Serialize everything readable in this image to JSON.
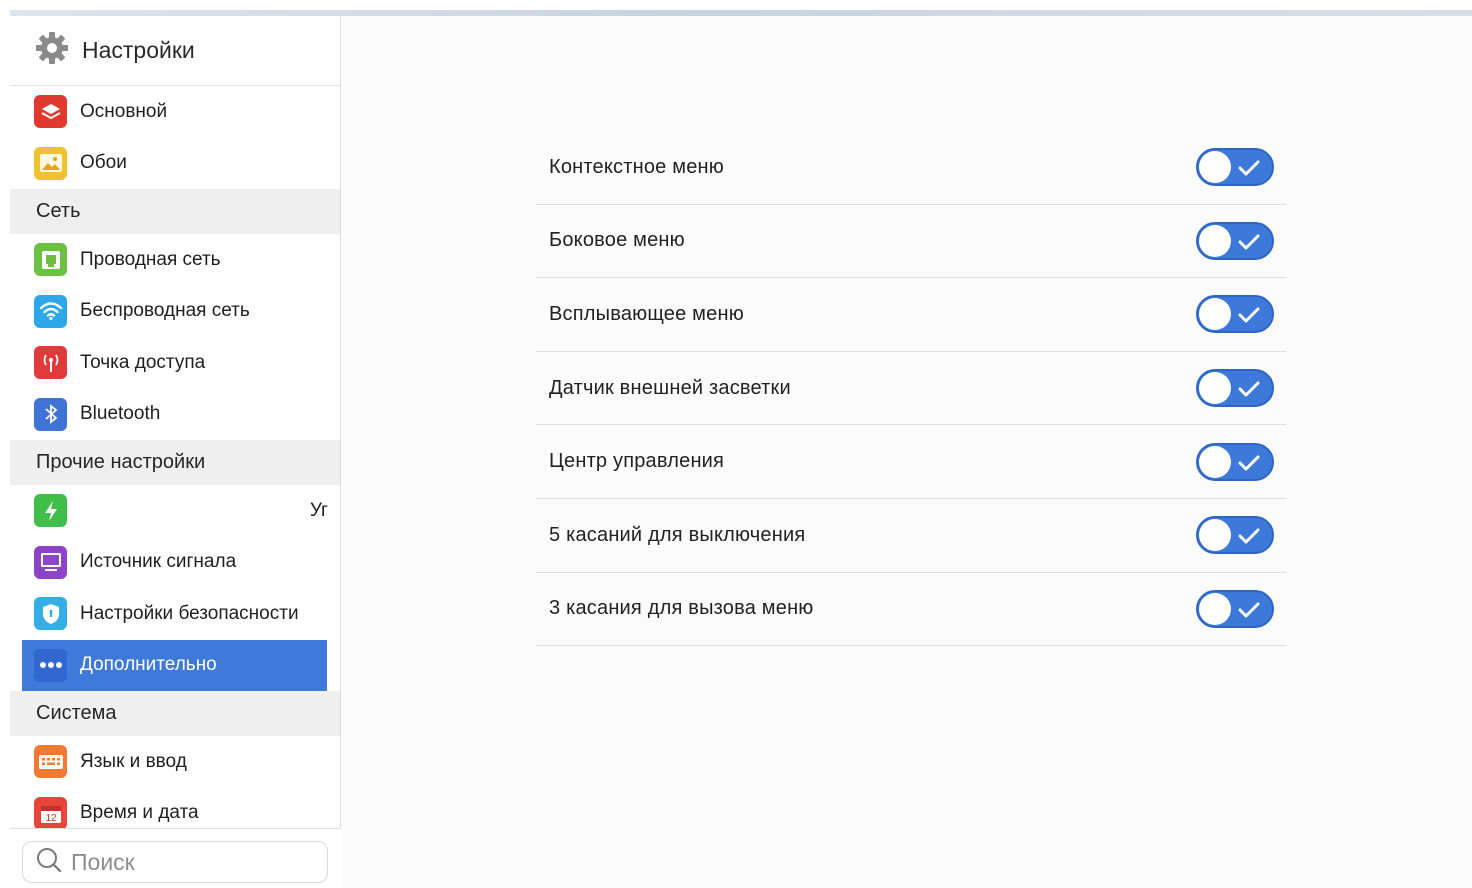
{
  "sidebar": {
    "title": "Настройки",
    "items": [
      {
        "kind": "item",
        "label": "Основной",
        "icon": "layers-icon",
        "color": "#e0392d"
      },
      {
        "kind": "item",
        "label": "Обои",
        "icon": "image-icon",
        "color": "#f2c12e"
      },
      {
        "kind": "section",
        "label": "Сеть"
      },
      {
        "kind": "item",
        "label": "Проводная сеть",
        "icon": "ethernet-icon",
        "color": "#6cc142"
      },
      {
        "kind": "item",
        "label": "Беспроводная сеть",
        "icon": "wifi-icon",
        "color": "#2ea7e8"
      },
      {
        "kind": "item",
        "label": "Точка доступа",
        "icon": "hotspot-icon",
        "color": "#e03a3a"
      },
      {
        "kind": "item",
        "label": "Bluetooth",
        "icon": "bluetooth-icon",
        "color": "#3f74d6"
      },
      {
        "kind": "section",
        "label": "Прочие настройки"
      },
      {
        "kind": "item",
        "label": "",
        "trail": "Уг",
        "icon": "power-icon",
        "color": "#3fbf4a"
      },
      {
        "kind": "item",
        "label": "Источник сигнала",
        "icon": "monitor-icon",
        "color": "#8b44c8"
      },
      {
        "kind": "item",
        "label": "Настройки безопасности",
        "icon": "shield-icon",
        "color": "#35aee6"
      },
      {
        "kind": "item",
        "label": "Дополнительно",
        "icon": "more-icon",
        "color": "#3167cf",
        "selected": true
      },
      {
        "kind": "section",
        "label": "Система"
      },
      {
        "kind": "item",
        "label": "Язык и ввод",
        "icon": "keyboard-icon",
        "color": "#ef7a33"
      },
      {
        "kind": "item",
        "label": "Время и дата",
        "icon": "calendar-icon",
        "color": "#e7453a",
        "badge": "12"
      }
    ]
  },
  "search": {
    "placeholder": "Поиск"
  },
  "settings": [
    {
      "label": "Контекстное меню",
      "on": true
    },
    {
      "label": "Боковое меню",
      "on": true
    },
    {
      "label": "Всплывающее меню",
      "on": true
    },
    {
      "label": "Датчик внешней засветки",
      "on": true
    },
    {
      "label": "Центр управления",
      "on": true
    },
    {
      "label": "5 касаний для выключения",
      "on": true
    },
    {
      "label": "3 касания для вызова меню",
      "on": true
    }
  ],
  "colors": {
    "accent": "#3f7ad8",
    "section_bg": "#efefef"
  }
}
